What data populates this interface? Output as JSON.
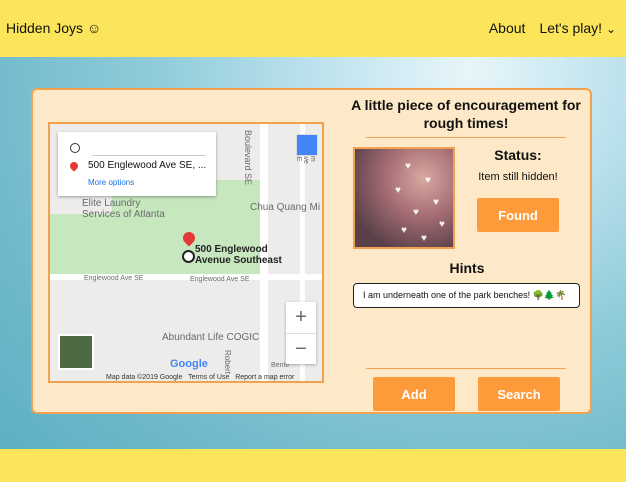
{
  "navbar": {
    "brand": "Hidden Joys",
    "brand_icon": "☺",
    "links": [
      {
        "label": "About"
      },
      {
        "label": "Let's play!"
      }
    ],
    "dropdown_icon": "⌄"
  },
  "map": {
    "info_address": "500 Englewood Ave SE, ...",
    "info_more": "More options",
    "labels": {
      "laundry": "Elite Laundry\nServices of Atlanta",
      "chua": "Chua Quang Mi",
      "boulevard": "Boulevard SE",
      "englewood_left": "Englewood Ave SE",
      "englewood_right": "Englewood Ave SE",
      "abundant": "Abundant Life COGIC",
      "marker": "500 Englewood\nAvenue Southeast",
      "hm_ave": "hm Ave SE",
      "robert": "Robert",
      "benteen": "Bente"
    },
    "zoom_in": "+",
    "zoom_out": "−",
    "google": "Google",
    "attribution": {
      "data": "Map data ©2019 Google",
      "terms": "Terms of Use",
      "report": "Report a map error"
    }
  },
  "headline": "A little piece of encouragement for rough times!",
  "status": {
    "label": "Status:",
    "value": "Item still hidden!"
  },
  "buttons": {
    "found": "Found",
    "add": "Add",
    "search": "Search"
  },
  "hints": {
    "label": "Hints",
    "items": [
      "I am underneath one of the park benches! 🌳🌲🌴"
    ]
  },
  "colors": {
    "navbar": "#fce55a",
    "card_bg": "#fde8c7",
    "accent": "#fd9a3a",
    "border": "#f0a251"
  }
}
